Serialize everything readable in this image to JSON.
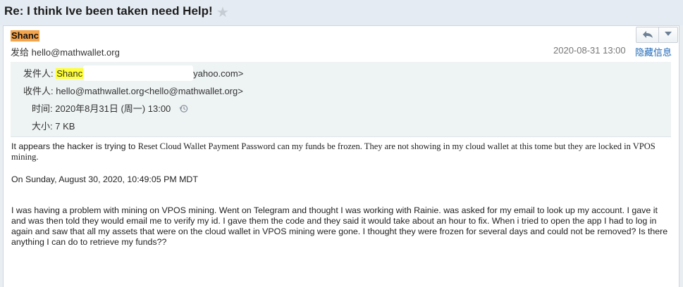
{
  "subject": "Re: I think Ive been taken need Help!",
  "header": {
    "sender_short": "Shanc",
    "to_prefix": "发给",
    "to_address": "hello@mathwallet.org",
    "date": "2020-08-31 13:00",
    "hide_info_label": "隐藏信息"
  },
  "details": {
    "from_label": "发件人:",
    "from_name": "Shanc",
    "from_domain": "yahoo.com>",
    "to_label": "收件人:",
    "to_value": "hello@mathwallet.org<hello@mathwallet.org>",
    "time_label": "时间:",
    "time_value": "2020年8月31日 (周一) 13:00",
    "size_label": "大小:",
    "size_value": "7 KB"
  },
  "body": {
    "line1_sans": "It appears the hacker is trying to ",
    "line1_serif": "Reset Cloud Wallet Payment Password can my funds be frozen. They are not showing in my cloud wallet at this tome but they are locked in VPOS mining.",
    "quote_header": "On Sunday, August 30, 2020, 10:49:05 PM MDT",
    "paragraph": "I was having a problem with mining on VPOS mining. Went on Telegram and thought I was working with Rainie. was asked for my email to look up my account. I gave it and was then told they would email me to verify my id. I gave them the code and they said it would take about an hour to fix. When i tried to open the app I had to log in again and saw that all my assets that were on the cloud wallet in VPOS mining were gone. I thought they were frozen for several days and could not be removed? Is there anything I can do to retrieve my funds??"
  },
  "icons": {
    "star": "star-icon",
    "reply": "reply-icon",
    "more": "chevron-down-icon",
    "history": "clock-history-icon"
  },
  "colors": {
    "sender_highlight": "#f6a44a",
    "from_highlight": "#ffff33",
    "link": "#1d68b7"
  }
}
